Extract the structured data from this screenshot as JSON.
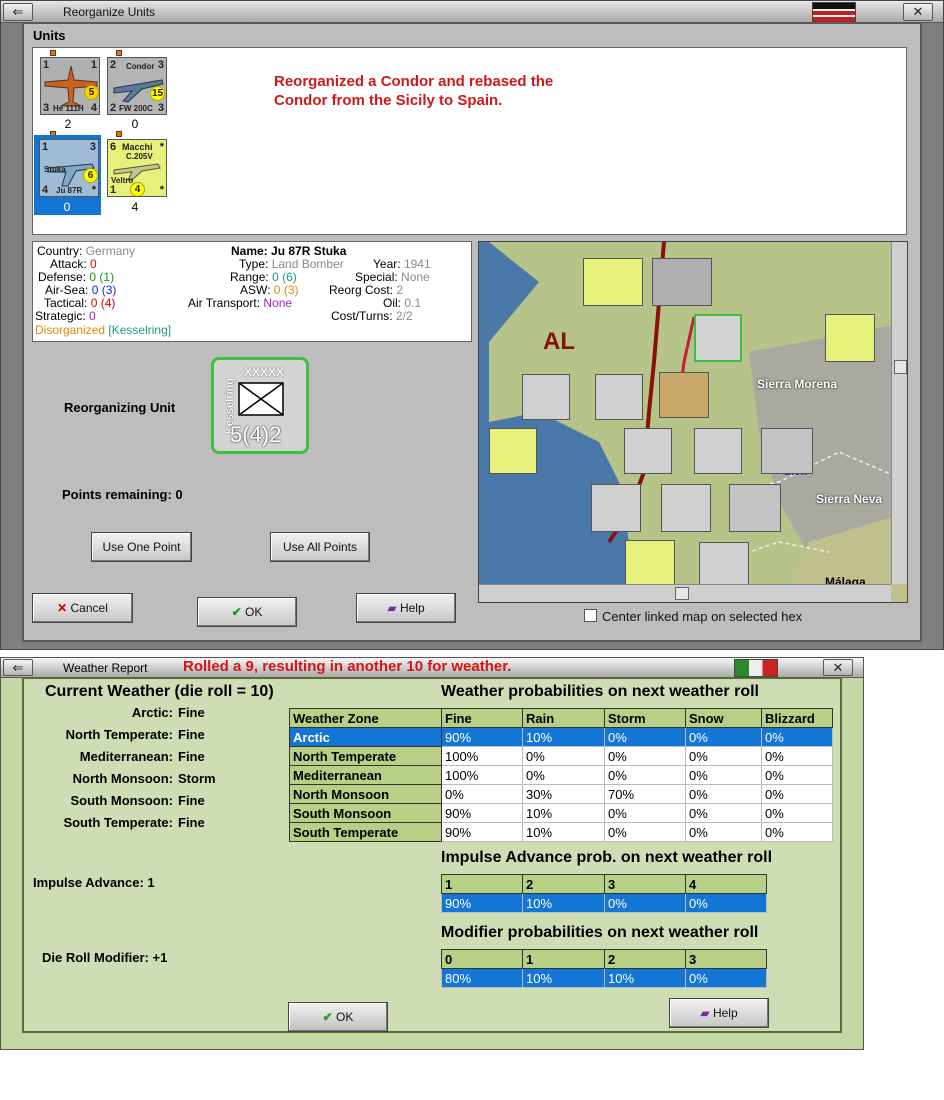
{
  "reorg_window": {
    "title": "Reorganize Units",
    "units_label": "Units",
    "message_line1": "Reorganized a Condor and rebased the",
    "message_line2": "Condor from the Sicily to Spain.",
    "units": [
      {
        "name": "He 111H",
        "top_left": "1",
        "top_right": "1",
        "bottom_left": "3",
        "bottom_right": "4",
        "circle": "5",
        "count": "2"
      },
      {
        "name": "Condor",
        "subname": "FW 200C",
        "top_left": "2",
        "top_right": "3",
        "bottom_left": "2",
        "bottom_right": "3",
        "circle": "15",
        "count": "0"
      },
      {
        "name": "Ju 87R",
        "subname": "Stuka",
        "top_left": "1",
        "top_right": "3",
        "bottom_left": "4",
        "bottom_right": "*",
        "circle": "6",
        "count": "0"
      },
      {
        "name": "Macchi",
        "subname": "C.205V",
        "extra": "Veltro",
        "top_left": "6",
        "top_right": "*",
        "bottom_left": "1",
        "bottom_right": "*",
        "circle": "4",
        "count": "4"
      }
    ],
    "info": {
      "country_label": "Country:",
      "country": "Germany",
      "attack_label": "Attack:",
      "attack": "0",
      "defense_label": "Defense:",
      "defense": "0",
      "defense_paren": "(1)",
      "airsea_label": "Air-Sea:",
      "airsea": "0",
      "airsea_paren": "(3)",
      "tactical_label": "Tactical:",
      "tactical": "0",
      "tactical_paren": "(4)",
      "strategic_label": "Strategic:",
      "strategic": "0",
      "status": "Disorganized",
      "commander": "[Kesselring]",
      "name_label": "Name:",
      "name": "Ju 87R Stuka",
      "type_label": "Type:",
      "type": "Land Bomber",
      "year_label": "Year:",
      "year": "1941",
      "range_label": "Range:",
      "range": "0",
      "range_paren": "(6)",
      "special_label": "Special:",
      "special": "None",
      "asw_label": "ASW:",
      "asw": "0",
      "asw_paren": "(3)",
      "reorg_label": "Reorg Cost:",
      "reorg": "2",
      "airtrans_label": "Air Transport:",
      "airtrans": "None",
      "oil_label": "Oil:",
      "oil": "0.1",
      "cost_label": "Cost/Turns:",
      "cost": "2/2"
    },
    "reorganizing_label": "Reorganizing Unit",
    "reorg_counter": {
      "name": "Kesselring",
      "size": "XXXXX",
      "value": "5(4)2"
    },
    "points_label": "Points remaining:",
    "points": "0",
    "use_one": "Use One Point",
    "use_all": "Use All Points",
    "cancel": "Cancel",
    "ok": "OK",
    "help": "Help",
    "center_map": "Center linked map on selected hex",
    "map_labels": {
      "al": "AL",
      "sierra_morena": "Sierra Morena",
      "sierra_nevada": "Sierra Neva",
      "malaga": "Málaga",
      "guadal": "uivir"
    }
  },
  "weather_window": {
    "title": "Weather Report",
    "headline": "Rolled a 9, resulting in another 10 for weather.",
    "current_title": "Current Weather (die roll = 10)",
    "current": [
      {
        "zone": "Arctic:",
        "value": "Fine"
      },
      {
        "zone": "North Temperate:",
        "value": "Fine"
      },
      {
        "zone": "Mediterranean:",
        "value": "Fine"
      },
      {
        "zone": "North Monsoon:",
        "value": "Storm"
      },
      {
        "zone": "South Monsoon:",
        "value": "Fine"
      },
      {
        "zone": "South Temperate:",
        "value": "Fine"
      }
    ],
    "impulse_label": "Impulse Advance:",
    "impulse": "1",
    "modifier_label": "Die Roll Modifier:",
    "modifier": "+1",
    "prob_title": "Weather probabilities on next weather roll",
    "prob_headers": [
      "Weather Zone",
      "Fine",
      "Rain",
      "Storm",
      "Snow",
      "Blizzard"
    ],
    "prob_rows": [
      [
        "Arctic",
        "90%",
        "10%",
        "0%",
        "0%",
        "0%"
      ],
      [
        "North Temperate",
        "100%",
        "0%",
        "0%",
        "0%",
        "0%"
      ],
      [
        "Mediterranean",
        "100%",
        "0%",
        "0%",
        "0%",
        "0%"
      ],
      [
        "North Monsoon",
        "0%",
        "30%",
        "70%",
        "0%",
        "0%"
      ],
      [
        "South Monsoon",
        "90%",
        "10%",
        "0%",
        "0%",
        "0%"
      ],
      [
        "South Temperate",
        "90%",
        "10%",
        "0%",
        "0%",
        "0%"
      ]
    ],
    "impulse_title": "Impulse Advance prob. on next weather roll",
    "impulse_headers": [
      "1",
      "2",
      "3",
      "4"
    ],
    "impulse_row": [
      "90%",
      "10%",
      "0%",
      "0%"
    ],
    "modifier_title": "Modifier probabilities on next weather roll",
    "modifier_headers": [
      "0",
      "1",
      "2",
      "3"
    ],
    "modifier_row": [
      "80%",
      "10%",
      "10%",
      "0%"
    ],
    "ok": "OK",
    "help": "Help"
  },
  "colors": {
    "selection": "#1476d4",
    "message": "#d01818",
    "header_green": "#b8cf86"
  }
}
